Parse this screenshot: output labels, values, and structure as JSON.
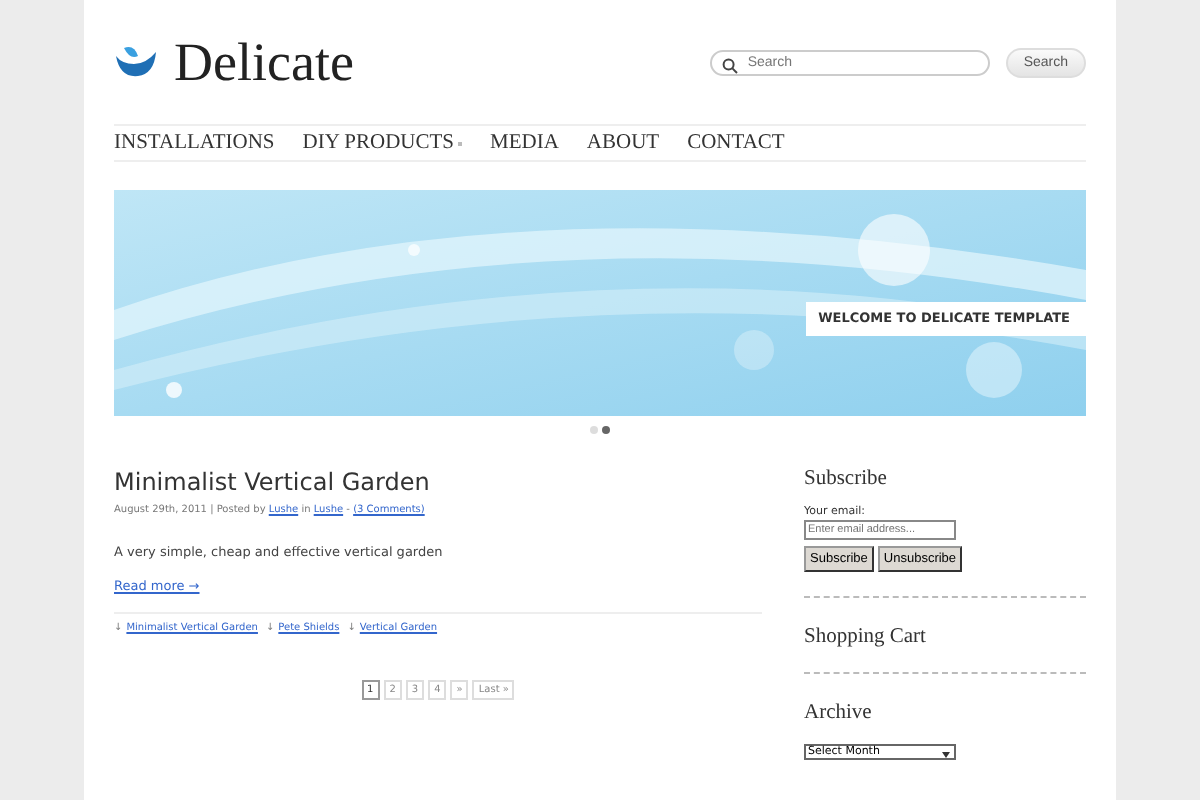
{
  "site": {
    "title": "Delicate"
  },
  "search": {
    "placeholder": "Search",
    "button": "Search"
  },
  "nav": [
    {
      "label": "INSTALLATIONS",
      "has_submenu": false
    },
    {
      "label": "DIY PRODUCTS",
      "has_submenu": true
    },
    {
      "label": "MEDIA",
      "has_submenu": false
    },
    {
      "label": "ABOUT",
      "has_submenu": false
    },
    {
      "label": "CONTACT",
      "has_submenu": false
    }
  ],
  "slider": {
    "caption": "WELCOME TO DELICATE TEMPLATE",
    "dots": [
      {
        "selected": false
      },
      {
        "selected": true
      }
    ]
  },
  "post": {
    "title": "Minimalist Vertical Garden",
    "date": "August 29th, 2011 | Posted by",
    "author": "Lushe",
    "in": "in",
    "category": "Lushe",
    "dash": "-",
    "comments": "(3 Comments)",
    "excerpt": "A very simple, cheap and effective vertical garden",
    "read_more": "Read more →",
    "tags": [
      {
        "icon": "↓",
        "label": "Minimalist Vertical Garden"
      },
      {
        "icon": "↓",
        "label": "Pete Shields"
      },
      {
        "icon": "↓",
        "label": "Vertical Garden"
      }
    ]
  },
  "pagination": [
    {
      "label": "1",
      "selected": true
    },
    {
      "label": "2",
      "selected": false
    },
    {
      "label": "3",
      "selected": false
    },
    {
      "label": "4",
      "selected": false
    },
    {
      "label": "»",
      "selected": false
    },
    {
      "label": "Last »",
      "selected": false
    }
  ],
  "sidebar": {
    "subscribe": {
      "title": "Subscribe",
      "email_label": "Your email:",
      "placeholder": "Enter email address...",
      "buttons": [
        "Subscribe",
        "Unsubscribe"
      ]
    },
    "cart": {
      "title": "Shopping Cart"
    },
    "archive": {
      "title": "Archive",
      "select": "Select Month"
    }
  }
}
